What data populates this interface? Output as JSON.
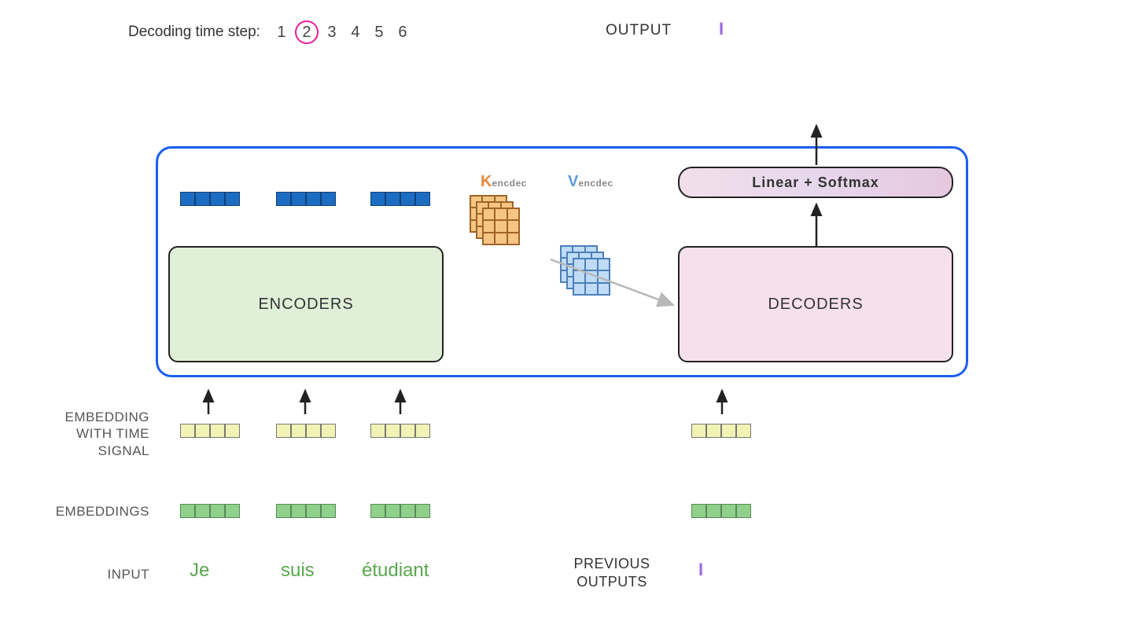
{
  "header": {
    "timestep_label": "Decoding time step:",
    "steps": [
      "1",
      "2",
      "3",
      "4",
      "5",
      "6"
    ],
    "active_step_index": 1,
    "output_label": "OUTPUT",
    "output_token": "I"
  },
  "blocks": {
    "encoders_label": "ENCODERS",
    "decoders_label": "DECODERS",
    "linear_label": "Linear + Softmax"
  },
  "kv": {
    "k_letter": "K",
    "k_sub": "encdec",
    "v_letter": "V",
    "v_sub": "encdec"
  },
  "row_labels": {
    "embedding_time": "EMBEDDING WITH TIME SIGNAL",
    "embeddings": "EMBEDDINGS",
    "input": "INPUT",
    "previous_outputs": "PREVIOUS OUTPUTS"
  },
  "inputs": [
    "Je",
    "suis",
    "étudiant"
  ],
  "previous_output_token": "I"
}
